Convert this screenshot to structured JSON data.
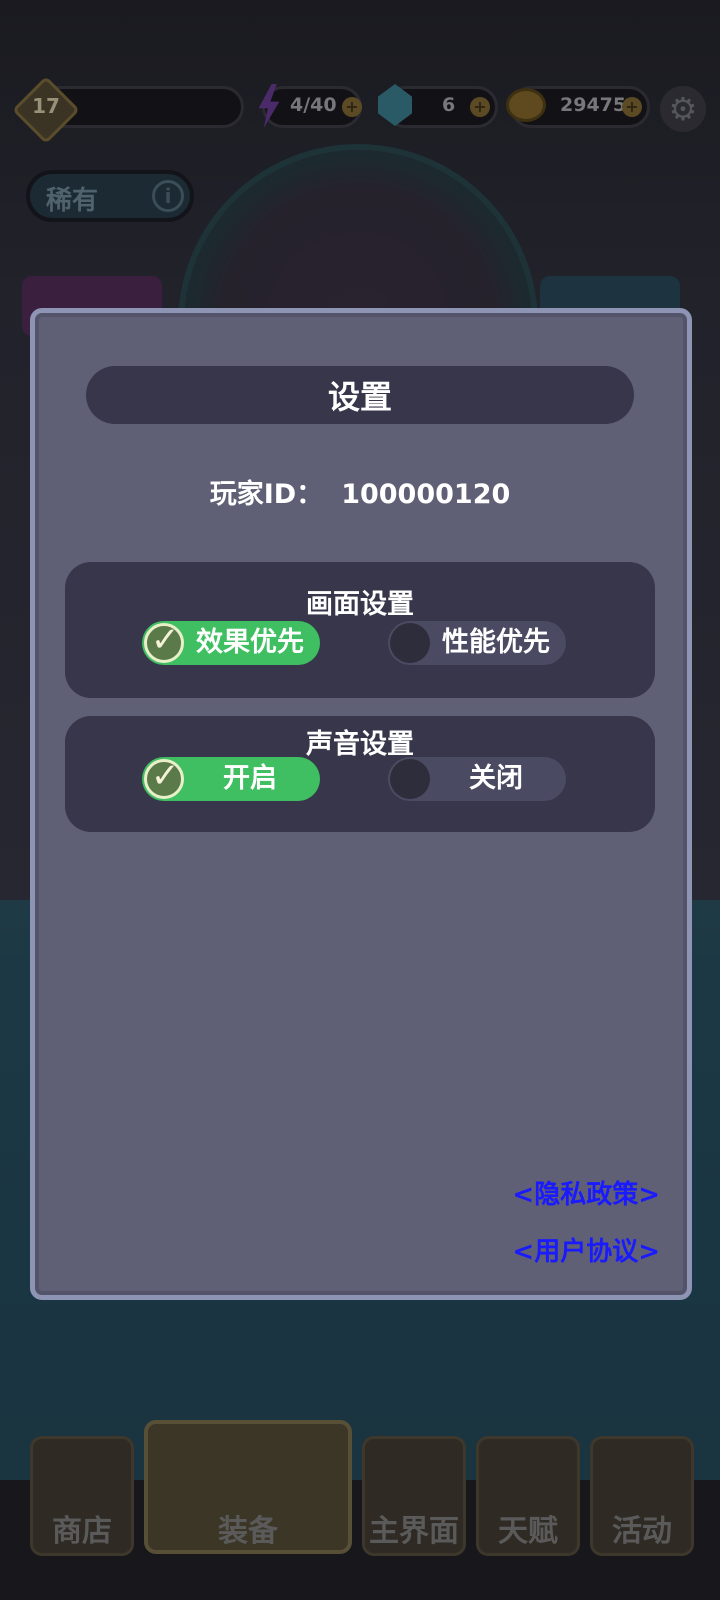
{
  "hud": {
    "level": "17",
    "energy": "4/40",
    "gems": "6",
    "gold": "29475"
  },
  "hero": {
    "rarity": "稀有"
  },
  "settings": {
    "title": "设置",
    "player_id_label": "玩家ID：",
    "player_id": "100000120",
    "graphics": {
      "title": "画面设置",
      "options": [
        {
          "label": "效果优先",
          "selected": true
        },
        {
          "label": "性能优先",
          "selected": false
        }
      ]
    },
    "sound": {
      "title": "声音设置",
      "options": [
        {
          "label": "开启",
          "selected": true
        },
        {
          "label": "关闭",
          "selected": false
        }
      ]
    },
    "links": {
      "privacy": "<隐私政策>",
      "terms": "<用户协议>"
    }
  },
  "nav": {
    "items": [
      {
        "label": "商店"
      },
      {
        "label": "装备"
      },
      {
        "label": "主界面"
      },
      {
        "label": "天赋"
      },
      {
        "label": "活动"
      }
    ]
  },
  "colors": {
    "modal_bg": "#5f5f76",
    "panel_bg": "#37364a",
    "toggle_on": "#3fbf62",
    "toggle_off": "#4a4a62",
    "link": "#1a1aff"
  },
  "icons": {
    "energy": "lightning-icon",
    "gems": "gem-icon",
    "gold": "gold-coin-icon",
    "settings": "gear-icon",
    "info": "info-icon",
    "check": "check-icon"
  }
}
